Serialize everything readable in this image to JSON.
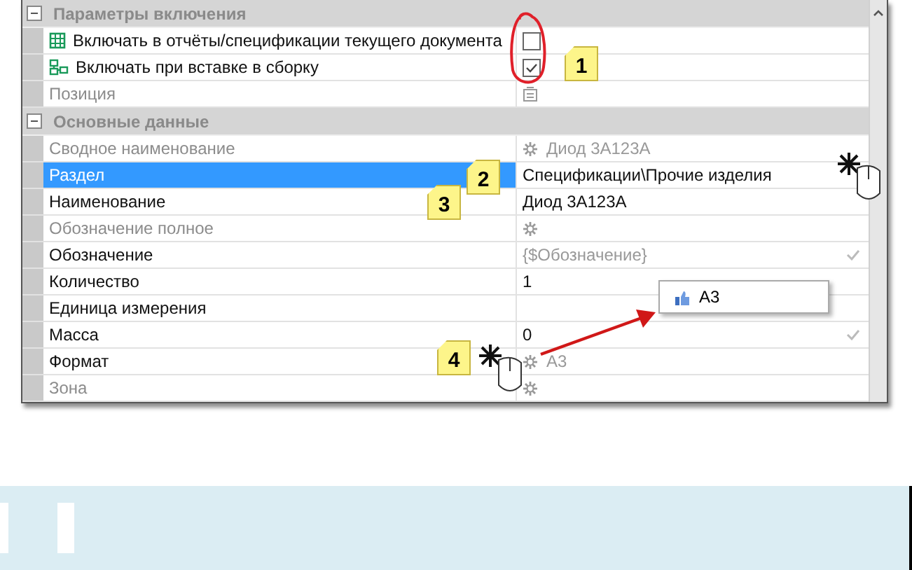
{
  "groups": [
    {
      "title": "Параметры включения",
      "expanded": true,
      "rows": [
        {
          "kind": "option",
          "label": "Включать в отчёты/спецификации текущего документа",
          "muted": false,
          "selected": false,
          "value": {
            "kind": "checkbox",
            "checked": false
          }
        },
        {
          "kind": "option",
          "label": "Включать при вставке в сборку",
          "muted": false,
          "selected": false,
          "value": {
            "kind": "checkbox",
            "checked": true
          }
        },
        {
          "kind": "plain",
          "label": "Позиция",
          "muted": true,
          "selected": false,
          "value": {
            "kind": "symbol"
          }
        }
      ]
    },
    {
      "title": "Основные данные",
      "expanded": true,
      "rows": [
        {
          "kind": "plain",
          "label": "Сводное наименование",
          "muted": true,
          "selected": false,
          "value": {
            "kind": "calc",
            "text": "Диод 3А123А",
            "muted": true,
            "tick": false
          }
        },
        {
          "kind": "plain",
          "label": "Раздел",
          "muted": false,
          "selected": true,
          "value": {
            "kind": "text",
            "text": "Спецификации\\Прочие изделия",
            "muted": false,
            "tick": false
          }
        },
        {
          "kind": "plain",
          "label": "Наименование",
          "muted": false,
          "selected": false,
          "value": {
            "kind": "text",
            "text": "Диод 3А123А",
            "muted": false,
            "tick": false
          }
        },
        {
          "kind": "plain",
          "label": "Обозначение полное",
          "muted": true,
          "selected": false,
          "value": {
            "kind": "calc",
            "muted": true,
            "tick": false
          }
        },
        {
          "kind": "plain",
          "label": "Обозначение",
          "muted": false,
          "selected": false,
          "value": {
            "kind": "text",
            "text": "{$Обозначение}",
            "muted": true,
            "tick": true
          }
        },
        {
          "kind": "plain",
          "label": "Количество",
          "muted": false,
          "selected": false,
          "value": {
            "kind": "text",
            "text": "1",
            "muted": false,
            "tick": false
          }
        },
        {
          "kind": "plain",
          "label": "Единица измерения",
          "muted": false,
          "selected": false,
          "value": {
            "kind": "empty"
          }
        },
        {
          "kind": "plain",
          "label": "Масса",
          "muted": false,
          "selected": false,
          "value": {
            "kind": "text",
            "text": "0",
            "muted": false,
            "tick": true
          }
        },
        {
          "kind": "plain",
          "label": "Формат",
          "muted": false,
          "selected": false,
          "value": {
            "kind": "calc",
            "text": "А3",
            "muted": true,
            "tick": false
          }
        },
        {
          "kind": "plain",
          "label": "Зона",
          "muted": true,
          "selected": false,
          "value": {
            "kind": "calc",
            "muted": true,
            "tick": false
          }
        }
      ]
    }
  ],
  "callouts": [
    "1",
    "2",
    "3",
    "4"
  ],
  "popup": {
    "text": "А3"
  }
}
